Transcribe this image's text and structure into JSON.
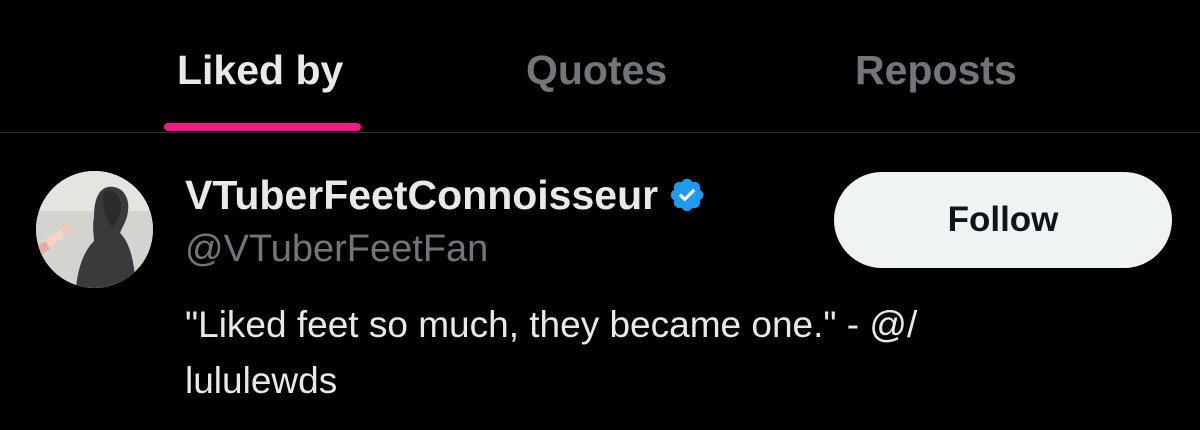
{
  "tabs": [
    {
      "label": "Liked by",
      "active": true
    },
    {
      "label": "Quotes",
      "active": false
    },
    {
      "label": "Reposts",
      "active": false
    }
  ],
  "colors": {
    "background": "#000000",
    "tab_indicator": "#f91880",
    "verified_badge": "#1d9bf0",
    "follow_button_bg": "#eff3f4",
    "muted_text": "#71767b"
  },
  "user": {
    "display_name": "VTuberFeetConnoisseur",
    "verified": true,
    "verified_icon": "verified-badge-icon",
    "handle": "@VTuberFeetFan",
    "bio_line1": "\"Liked feet so much, they became one.\" - @/",
    "bio_line2": "lululewds",
    "follow_label": "Follow"
  }
}
